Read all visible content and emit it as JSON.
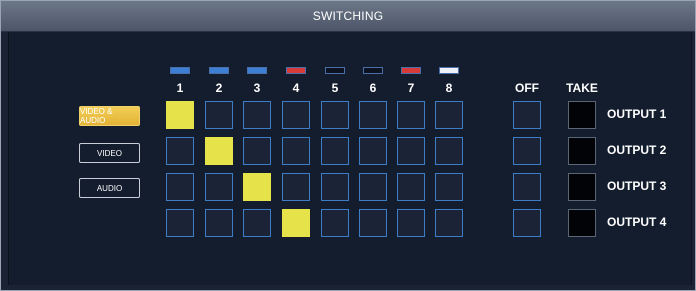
{
  "window": {
    "title": "SWITCHING"
  },
  "modes": [
    {
      "label": "VIDEO & AUDIO",
      "active": true
    },
    {
      "label": "VIDEO",
      "active": false
    },
    {
      "label": "AUDIO",
      "active": false
    }
  ],
  "inputs": [
    {
      "number": "1",
      "tally_color": "#3d7fd4"
    },
    {
      "number": "2",
      "tally_color": "#3d7fd4"
    },
    {
      "number": "3",
      "tally_color": "#3d7fd4"
    },
    {
      "number": "4",
      "tally_color": "#d83a3a"
    },
    {
      "number": "5",
      "tally_color": "#0c1220"
    },
    {
      "number": "6",
      "tally_color": "#0c1220"
    },
    {
      "number": "7",
      "tally_color": "#d83a3a"
    },
    {
      "number": "8",
      "tally_color": "#eef2f8"
    }
  ],
  "columns": {
    "off_label": "OFF",
    "take_label": "TAKE"
  },
  "outputs": [
    {
      "label": "OUTPUT 1",
      "selected_input": 1
    },
    {
      "label": "OUTPUT 2",
      "selected_input": 2
    },
    {
      "label": "OUTPUT 3",
      "selected_input": 3
    },
    {
      "label": "OUTPUT 4",
      "selected_input": 4
    }
  ],
  "colors": {
    "selected_cell": "#e6e24a",
    "cell_border": "#3e7cc6",
    "active_mode": "#e3b335",
    "background": "#141d2d"
  }
}
